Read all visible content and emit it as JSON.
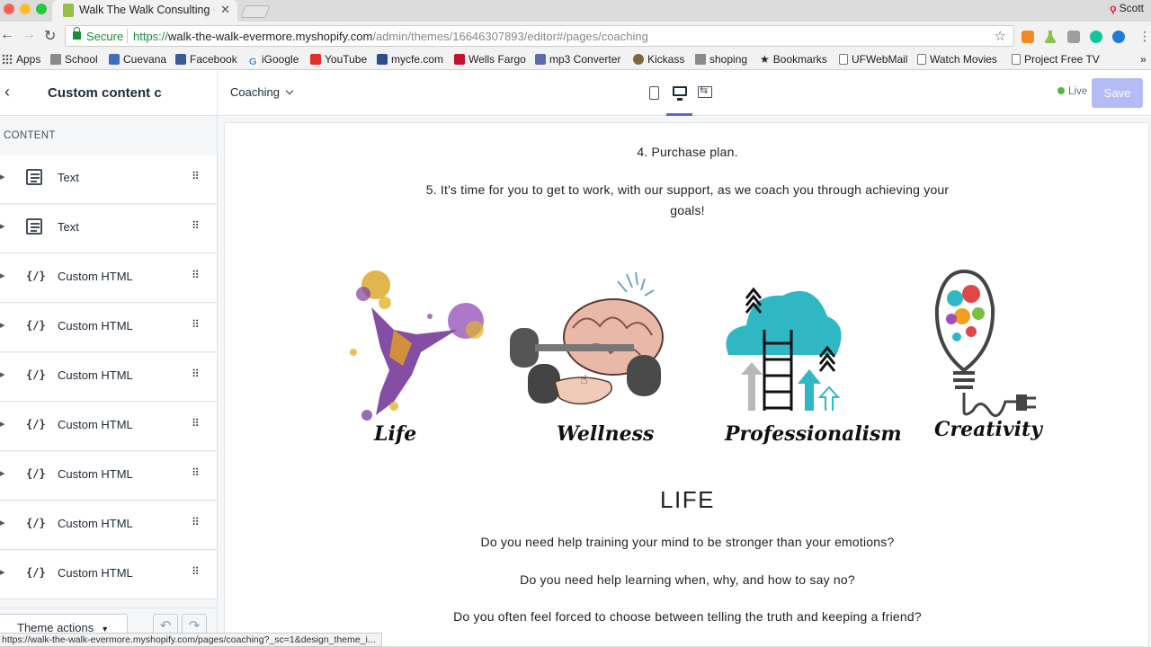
{
  "browser": {
    "tab_title": "Walk The Walk Consulting ~ Cu",
    "user_name": "Scott",
    "secure_label": "Secure",
    "url_scheme": "https://",
    "url_host": "walk-the-walk-evermore.myshopify.com",
    "url_path": "/admin/themes/16646307893/editor#/pages/coaching",
    "bookmarks": [
      {
        "label": "Apps",
        "icon": "apps-grid-icon"
      },
      {
        "label": "School",
        "icon": "folder-icon"
      },
      {
        "label": "Cuevana",
        "icon": "cuevana-icon"
      },
      {
        "label": "Facebook",
        "icon": "facebook-icon"
      },
      {
        "label": "iGoogle",
        "icon": "google-icon"
      },
      {
        "label": "YouTube",
        "icon": "youtube-icon"
      },
      {
        "label": "mycfe.com",
        "icon": "mycfe-icon"
      },
      {
        "label": "Wells Fargo",
        "icon": "wells-fargo-icon"
      },
      {
        "label": "mp3 Converter",
        "icon": "mp3-icon"
      },
      {
        "label": "Kickass",
        "icon": "kickass-icon"
      },
      {
        "label": "shoping",
        "icon": "folder-icon"
      },
      {
        "label": "Bookmarks",
        "icon": "star-icon"
      },
      {
        "label": "UFWebMail",
        "icon": "page-icon"
      },
      {
        "label": "Watch Movies",
        "icon": "page-icon"
      },
      {
        "label": "Project Free TV",
        "icon": "page-icon"
      }
    ],
    "status_url": "https://walk-the-walk-evermore.myshopify.com/pages/coaching?_sc=1&design_theme_i..."
  },
  "sidebar": {
    "title": "Custom content c",
    "section_label": "CONTENT",
    "items": [
      {
        "label": "Text",
        "icon": "text-block-icon"
      },
      {
        "label": "Text",
        "icon": "text-block-icon"
      },
      {
        "label": "Custom HTML",
        "icon": "code-icon"
      },
      {
        "label": "Custom HTML",
        "icon": "code-icon"
      },
      {
        "label": "Custom HTML",
        "icon": "code-icon"
      },
      {
        "label": "Custom HTML",
        "icon": "code-icon"
      },
      {
        "label": "Custom HTML",
        "icon": "code-icon"
      },
      {
        "label": "Custom HTML",
        "icon": "code-icon"
      },
      {
        "label": "Custom HTML",
        "icon": "code-icon"
      }
    ],
    "code_glyph": "{/}",
    "theme_actions_label": "Theme actions"
  },
  "topbar": {
    "page_select": "Coaching",
    "live_label": "Live",
    "save_label": "Save",
    "active_viewport": "desktop"
  },
  "preview": {
    "step4": "4. Purchase plan.",
    "step5_line1": "5. It's time for you to get to work, with our support, as we coach you through achieving your",
    "step5_line2": "goals!",
    "captions": [
      "Life",
      "Wellness",
      "Professionalism",
      "Creativity"
    ],
    "heading": "LIFE",
    "questions": [
      "Do you need help training your mind to be stronger than your emotions?",
      "Do you need help learning when, why, and how to say no?",
      "Do you often feel forced to choose between telling the truth and keeping a friend?"
    ]
  },
  "colors": {
    "shopify_green": "#95bf47",
    "secure_green": "#1a8a3a",
    "save_disabled": "#b3bcf5",
    "live_green": "#50b83c",
    "cloud_teal": "#2fb8c4"
  }
}
